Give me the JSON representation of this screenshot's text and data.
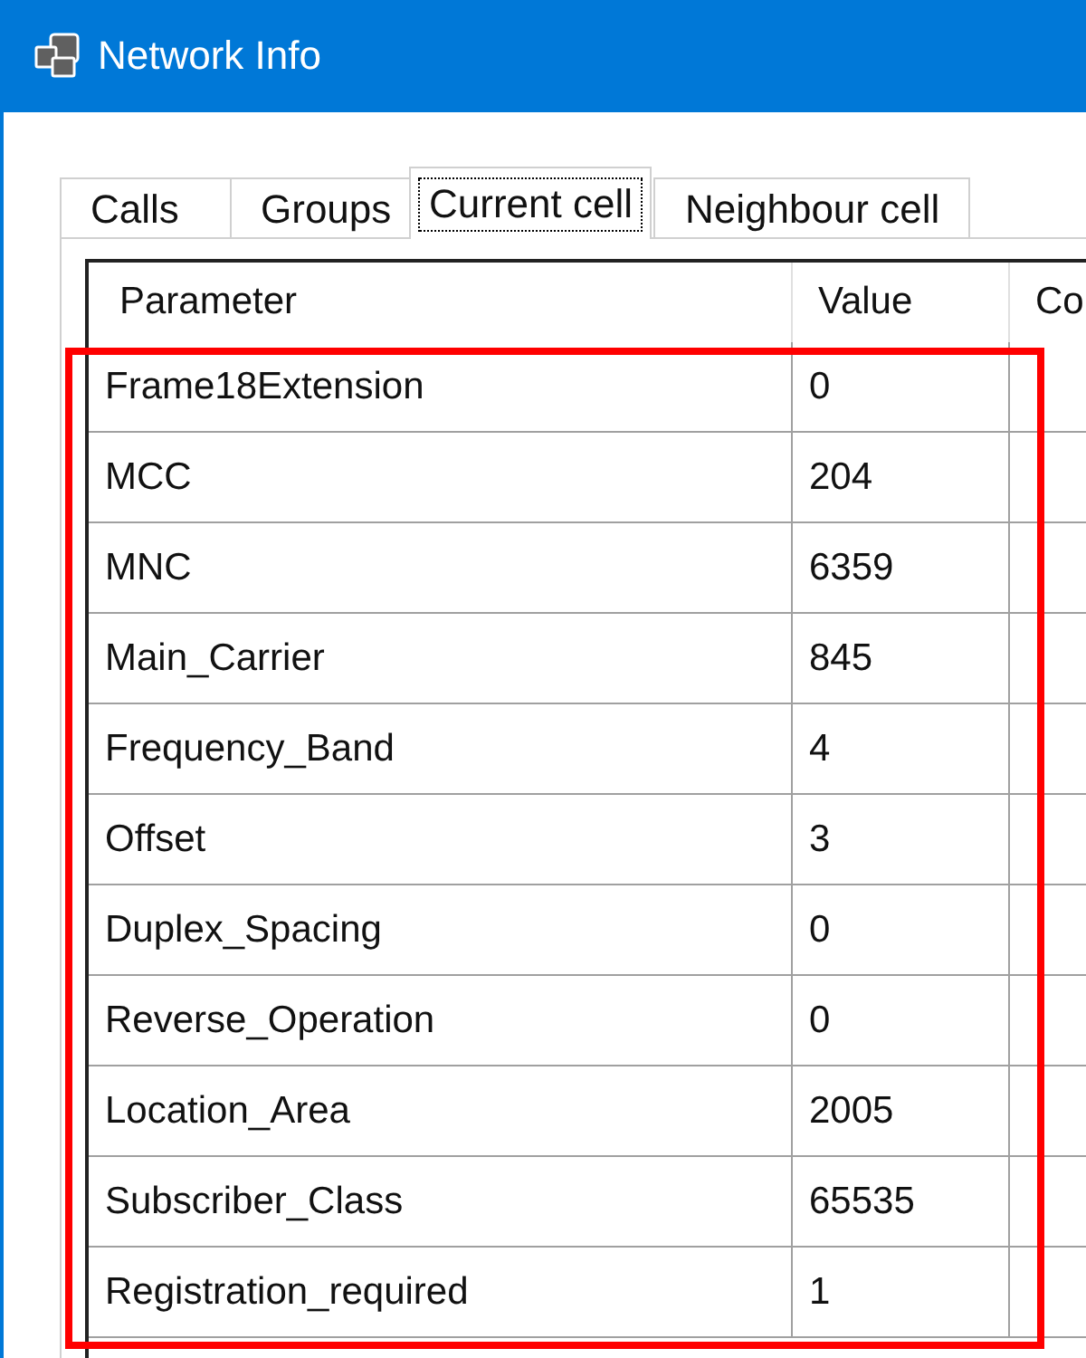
{
  "window": {
    "title": "Network Info"
  },
  "tabs": [
    {
      "label": "Calls",
      "selected": false
    },
    {
      "label": "Groups",
      "selected": false
    },
    {
      "label": "Current cell",
      "selected": true
    },
    {
      "label": "Neighbour cell",
      "selected": false
    }
  ],
  "table": {
    "columns": [
      "Parameter",
      "Value",
      "Co"
    ],
    "rows": [
      {
        "parameter": "Frame18Extension",
        "value": "0"
      },
      {
        "parameter": "MCC",
        "value": "204"
      },
      {
        "parameter": "MNC",
        "value": "6359"
      },
      {
        "parameter": "Main_Carrier",
        "value": "845"
      },
      {
        "parameter": "Frequency_Band",
        "value": "4"
      },
      {
        "parameter": "Offset",
        "value": "3"
      },
      {
        "parameter": "Duplex_Spacing",
        "value": "0"
      },
      {
        "parameter": "Reverse_Operation",
        "value": "0"
      },
      {
        "parameter": "Location_Area",
        "value": "2005"
      },
      {
        "parameter": "Subscriber_Class",
        "value": "65535"
      },
      {
        "parameter": "Registration_required",
        "value": "1"
      }
    ]
  },
  "highlight": {
    "kind": "frame",
    "color": "#ff0000"
  }
}
